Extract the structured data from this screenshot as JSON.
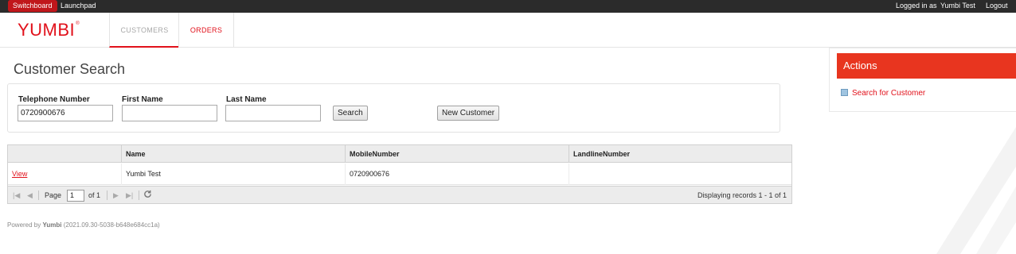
{
  "topbar": {
    "switchboard_label": "Switchboard",
    "launchpad_label": "Launchpad",
    "logged_in_label": "Logged in as",
    "user_name": "Yumbi Test",
    "logout_label": "Logout"
  },
  "header": {
    "logo_text": "YUMBI",
    "logo_mark": "®",
    "tabs": [
      {
        "label": "CUSTOMERS"
      },
      {
        "label": "ORDERS"
      }
    ]
  },
  "page": {
    "title": "Customer Search"
  },
  "search": {
    "telephone_label": "Telephone Number",
    "telephone_value": "0720900676",
    "first_name_label": "First Name",
    "first_name_value": "",
    "last_name_label": "Last Name",
    "last_name_value": "",
    "search_button": "Search",
    "new_customer_button": "New Customer"
  },
  "grid": {
    "columns": [
      "",
      "Name",
      "MobileNumber",
      "LandlineNumber"
    ],
    "rows": [
      {
        "action": "View",
        "name": "Yumbi Test",
        "mobile": "0720900676",
        "landline": ""
      }
    ],
    "pager": {
      "page_label": "Page",
      "page_value": "1",
      "of_label": "of 1",
      "status": "Displaying records 1 - 1 of 1"
    }
  },
  "footer": {
    "prefix": "Powered by",
    "brand": "Yumbi",
    "version": "(2021.09.30-5038-b648e684cc1a)"
  },
  "actions": {
    "title": "Actions",
    "items": [
      {
        "label": "Search for Customer",
        "icon": "search-customer-icon"
      }
    ]
  },
  "colors": {
    "brand_red": "#e1111b",
    "actions_header": "#e8351f",
    "topbar_bg": "#2b2b2b"
  }
}
